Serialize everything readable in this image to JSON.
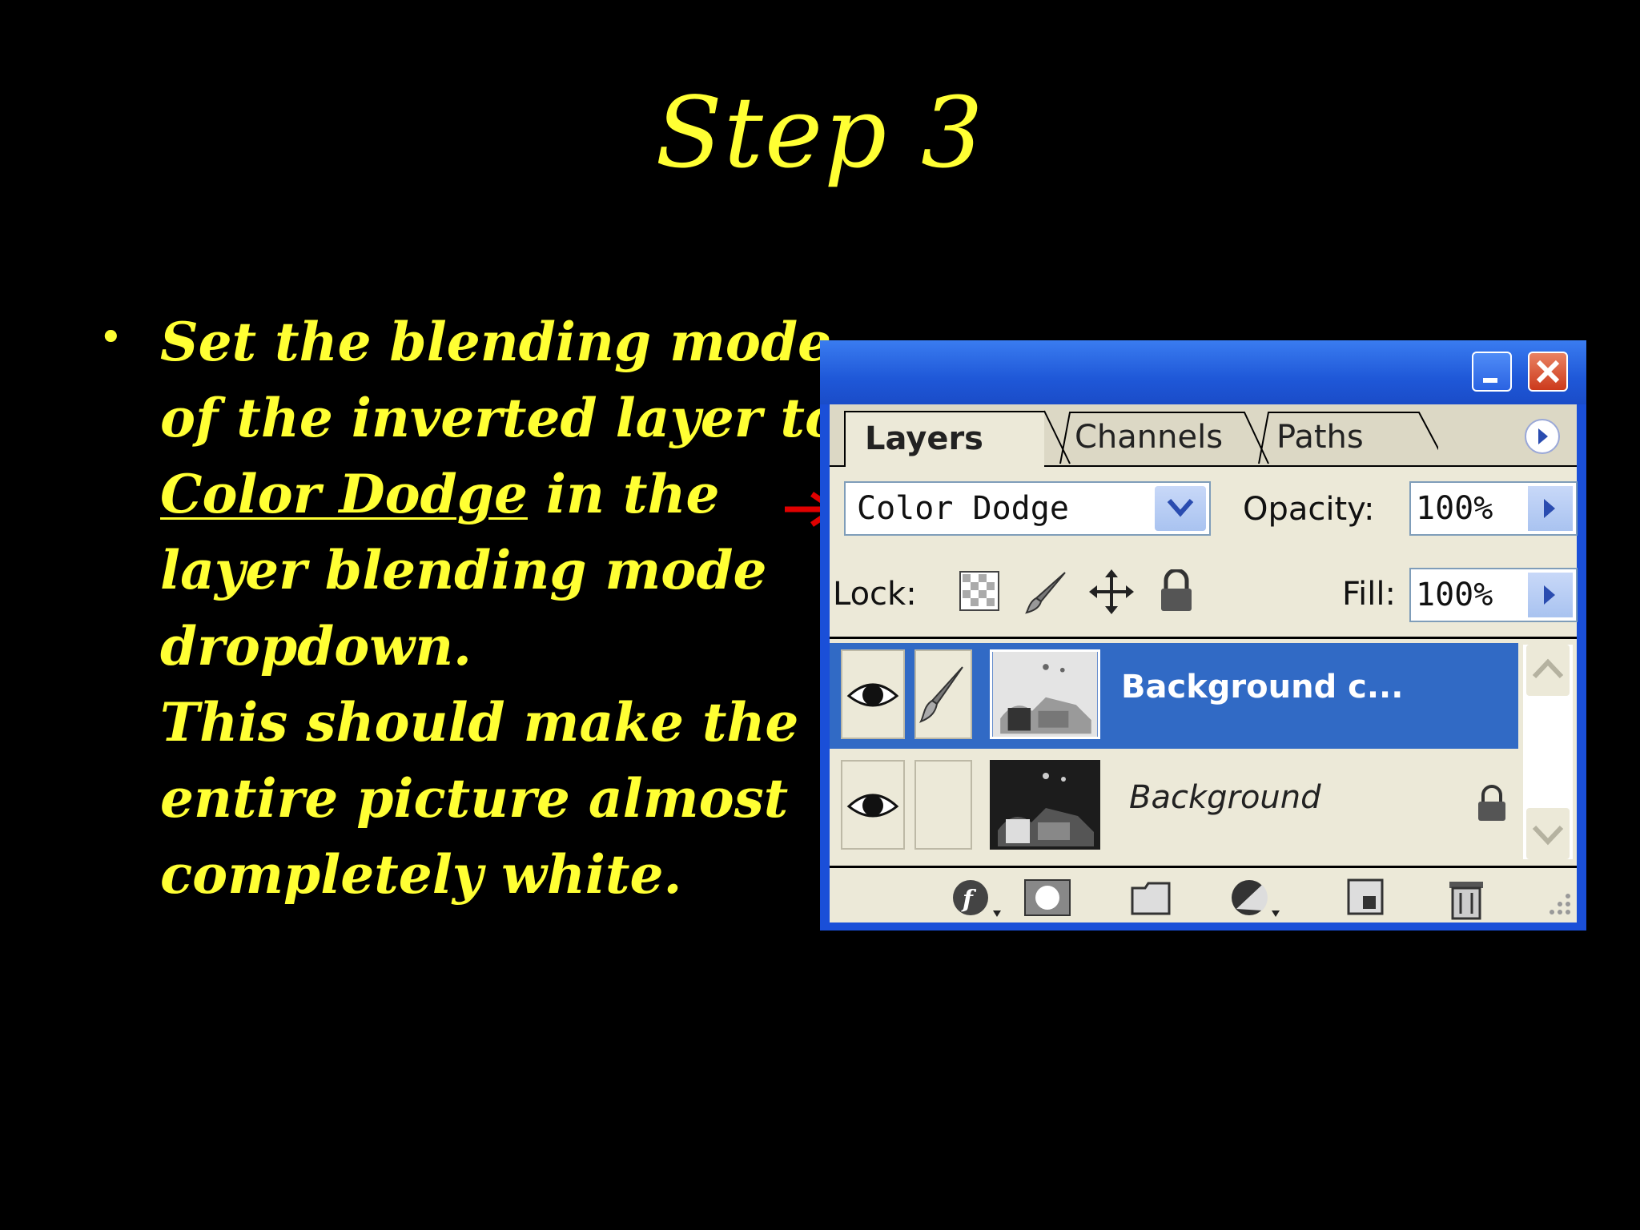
{
  "slide": {
    "title": "Step 3",
    "bullet": {
      "line1": "Set the blending mode",
      "line2": "of the inverted layer to",
      "highlight": "Color Dodge",
      "line3_rest": " in the",
      "line4": "layer blending mode",
      "line5": "dropdown.",
      "line6": "This should make the",
      "line7": "entire picture almost",
      "line8": "completely white."
    }
  },
  "colors": {
    "text": "#ffff33",
    "background": "#000000",
    "arrow": "#e00000",
    "selection": "#316ac5"
  },
  "palette": {
    "tabs": [
      "Layers",
      "Channels",
      "Paths"
    ],
    "active_tab": "Layers",
    "blend_mode": "Color Dodge",
    "opacity_label": "Opacity:",
    "opacity_value": "100%",
    "lock_label": "Lock:",
    "fill_label": "Fill:",
    "fill_value": "100%",
    "lock_icons": [
      "transparency-lock-icon",
      "brush-lock-icon",
      "move-lock-icon",
      "padlock-icon"
    ],
    "layers": [
      {
        "name": "Background c...",
        "selected": true
      },
      {
        "name": "Background",
        "selected": false,
        "locked": true
      }
    ],
    "bottom_icons": [
      "layer-style-icon",
      "layer-mask-icon",
      "new-group-icon",
      "adjustment-layer-icon",
      "new-layer-icon",
      "trash-icon"
    ]
  }
}
